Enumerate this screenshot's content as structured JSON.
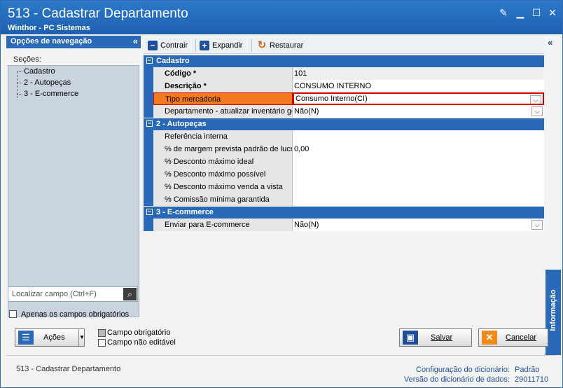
{
  "window": {
    "title": "513 - Cadastrar Departamento",
    "subtitle": "Winthor - PC Sistemas"
  },
  "nav": {
    "header": "Opções de navegação",
    "sections_label": "Seções:",
    "items": [
      "Cadastro",
      "2 - Autopeças",
      "3 - E-commerce"
    ],
    "search_placeholder": "Localizar campo (Ctrl+F)",
    "required_only_label": "Apenas os campos obrigatórios"
  },
  "toolbar": {
    "collapse_label": "Contrair",
    "expand_label": "Expandir",
    "restore_label": "Restaurar"
  },
  "grid": {
    "categories": [
      {
        "title": "Cadastro",
        "rows": [
          {
            "name": "Código *",
            "value": "101",
            "bold": true
          },
          {
            "name": "Descrição *",
            "value": "CONSUMO INTERNO",
            "bold": true
          },
          {
            "name": "Tipo mercadoria",
            "value": "Consumo Interno(CI)",
            "dropdown": true,
            "highlight": true
          },
          {
            "name": "Departamento - atualizar inventário geral",
            "value": "Não(N)",
            "dropdown": true
          }
        ]
      },
      {
        "title": "2 - Autopeças",
        "rows": [
          {
            "name": "Referência interna",
            "value": ""
          },
          {
            "name": "% de margem prevista padrão de lucro",
            "value": "0,00"
          },
          {
            "name": "% Desconto máximo ideal",
            "value": ""
          },
          {
            "name": "% Desconto máximo possível",
            "value": ""
          },
          {
            "name": "% Desconto máximo venda a vista",
            "value": ""
          },
          {
            "name": "% Comissão mínima garantida",
            "value": ""
          }
        ]
      },
      {
        "title": "3 - E-commerce",
        "rows": [
          {
            "name": "Enviar para E-commerce",
            "value": "Não(N)",
            "dropdown": true
          }
        ]
      }
    ]
  },
  "info_tab_label": "Informação",
  "legend": {
    "required": "Campo obrigatório",
    "not_editable": "Campo não editável"
  },
  "buttons": {
    "actions": "Ações",
    "save": "Salvar",
    "cancel": "Cancelar"
  },
  "footer": {
    "routine": "513 - Cadastrar Departamento",
    "dict_config_label": "Configuração do dicionário:",
    "dict_config_value": "Padrão",
    "dict_version_label": "Versão do dicionário de dados:",
    "dict_version_value": "29011710"
  },
  "colors": {
    "accent": "#2a68b8",
    "highlight": "#f47a20",
    "highlight_border": "#d60000"
  }
}
